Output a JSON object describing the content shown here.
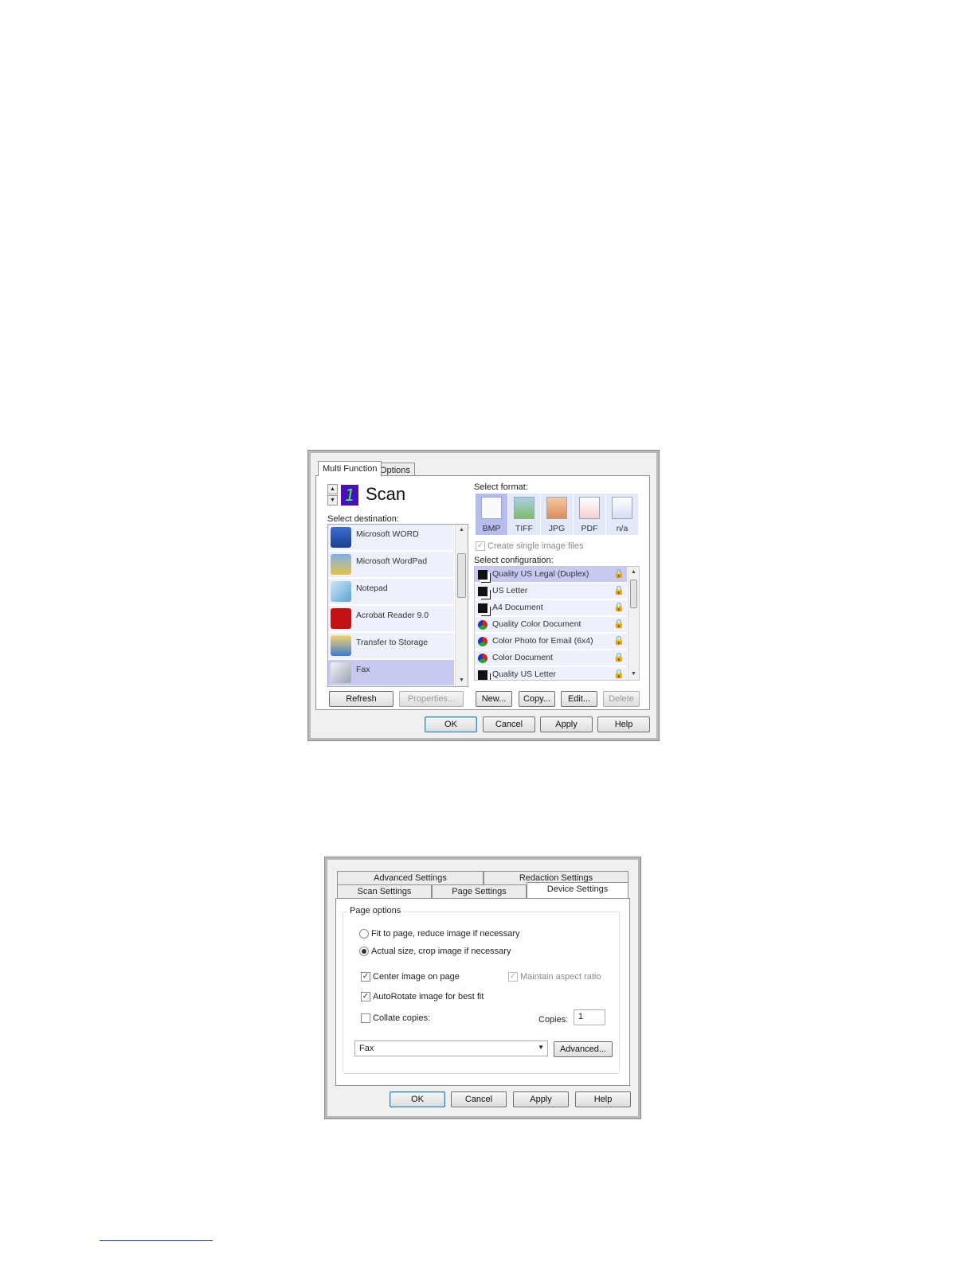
{
  "dialog1": {
    "tabs": [
      "Multi Function",
      "Options"
    ],
    "function_digit": "1",
    "function_name": "Scan",
    "select_destination_label": "Select destination:",
    "destinations": [
      {
        "label": "Microsoft WORD",
        "icon": "word-icon",
        "selected": false
      },
      {
        "label": "Microsoft WordPad",
        "icon": "wordpad-icon",
        "selected": false
      },
      {
        "label": "Notepad",
        "icon": "notepad-icon",
        "selected": false
      },
      {
        "label": "Acrobat Reader 9.0",
        "icon": "acrobat-icon",
        "selected": false
      },
      {
        "label": "Transfer to Storage",
        "icon": "storage-icon",
        "selected": false
      },
      {
        "label": "Fax",
        "icon": "fax-icon",
        "selected": true
      }
    ],
    "refresh_label": "Refresh",
    "properties_label": "Properties...",
    "select_format_label": "Select format:",
    "formats": [
      {
        "label": "BMP",
        "selected": true
      },
      {
        "label": "TIFF",
        "selected": false
      },
      {
        "label": "JPG",
        "selected": false
      },
      {
        "label": "PDF",
        "selected": false
      },
      {
        "label": "n/a",
        "selected": false
      }
    ],
    "single_image_label": "Create single image files",
    "select_configuration_label": "Select configuration:",
    "configurations": [
      {
        "label": "Quality US Legal (Duplex)",
        "color": "bw",
        "selected": true
      },
      {
        "label": "US Letter",
        "color": "bw",
        "selected": false
      },
      {
        "label": "A4 Document",
        "color": "bw",
        "selected": false
      },
      {
        "label": "Quality Color Document",
        "color": "color",
        "selected": false
      },
      {
        "label": "Color Photo for Email (6x4)",
        "color": "color",
        "selected": false
      },
      {
        "label": "Color Document",
        "color": "color",
        "selected": false
      },
      {
        "label": "Quality US Letter",
        "color": "bw",
        "selected": false
      }
    ],
    "new_label": "New...",
    "copy_label": "Copy...",
    "edit_label": "Edit...",
    "delete_label": "Delete",
    "ok_label": "OK",
    "cancel_label": "Cancel",
    "apply_label": "Apply",
    "help_label": "Help"
  },
  "dialog2": {
    "tabs_back": [
      "Advanced Settings",
      "Redaction Settings"
    ],
    "tabs_front": [
      "Scan Settings",
      "Page Settings",
      "Device Settings"
    ],
    "group_title": "Page options",
    "fit_to_page_label": "Fit to page, reduce image if necessary",
    "actual_size_label": "Actual size, crop image if necessary",
    "center_image_label": "Center image on page",
    "maintain_aspect_label": "Maintain aspect ratio",
    "autorotate_label": "AutoRotate image for best fit",
    "collate_label": "Collate copies:",
    "copies_label": "Copies:",
    "copies_value": "1",
    "printer_value": "Fax",
    "advanced_label": "Advanced...",
    "ok_label": "OK",
    "cancel_label": "Cancel",
    "apply_label": "Apply",
    "help_label": "Help"
  },
  "colors": {
    "selection": "#c7c9f2",
    "row": "#eef0fb",
    "format_selected": "#b6bcef"
  }
}
